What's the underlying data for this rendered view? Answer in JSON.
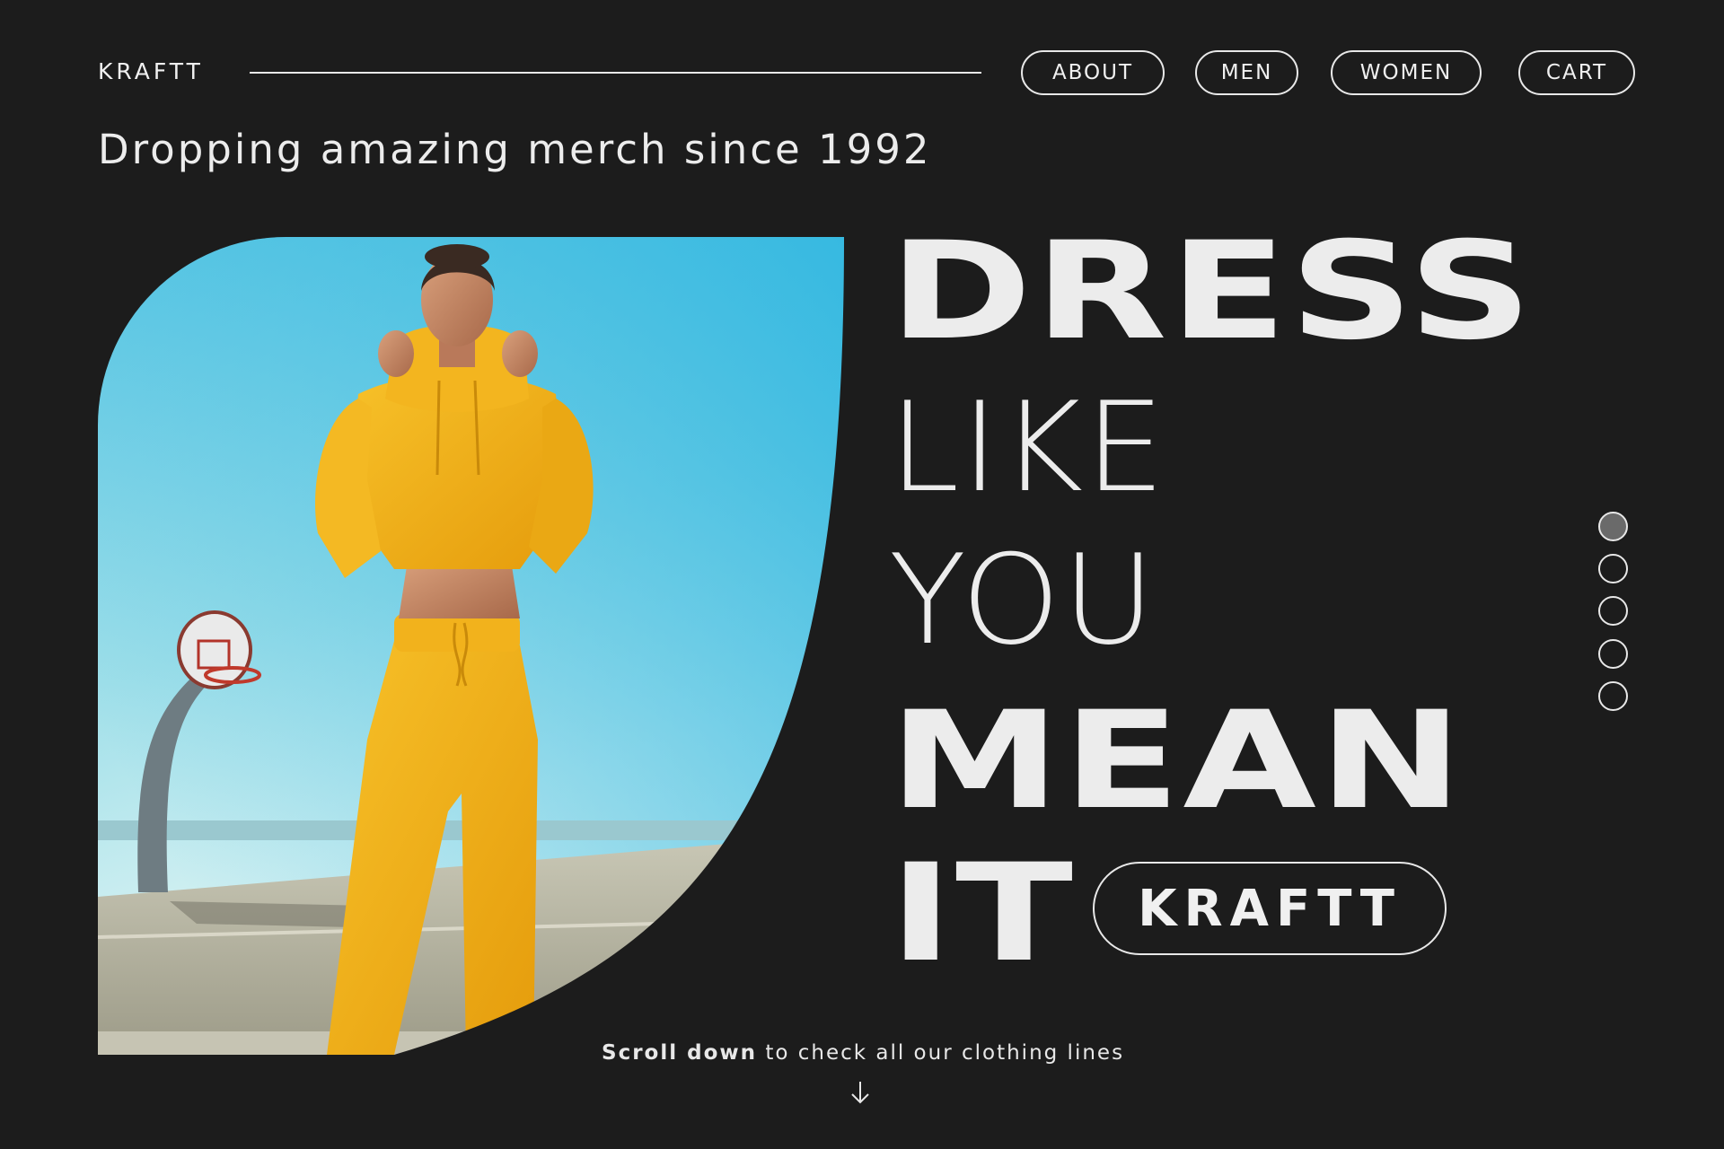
{
  "header": {
    "brand": "KRAFTT",
    "nav": [
      {
        "label": "ABOUT"
      },
      {
        "label": "MEN"
      },
      {
        "label": "WOMEN"
      },
      {
        "label": "CART"
      }
    ]
  },
  "tagline": "Dropping amazing merch since 1992",
  "headline": {
    "line1": "DRESS",
    "line2": "LIKE",
    "line3": "YOU",
    "line4": "MEAN",
    "line5": "IT",
    "badge": "KRAFTT"
  },
  "slider": {
    "count": 5,
    "active_index": 0
  },
  "scroll_hint": {
    "bold": "Scroll down",
    "rest": " to check all our clothing lines"
  },
  "colors": {
    "background": "#1c1c1c",
    "foreground": "#ececec",
    "active_dot": "#6a6a6a"
  }
}
